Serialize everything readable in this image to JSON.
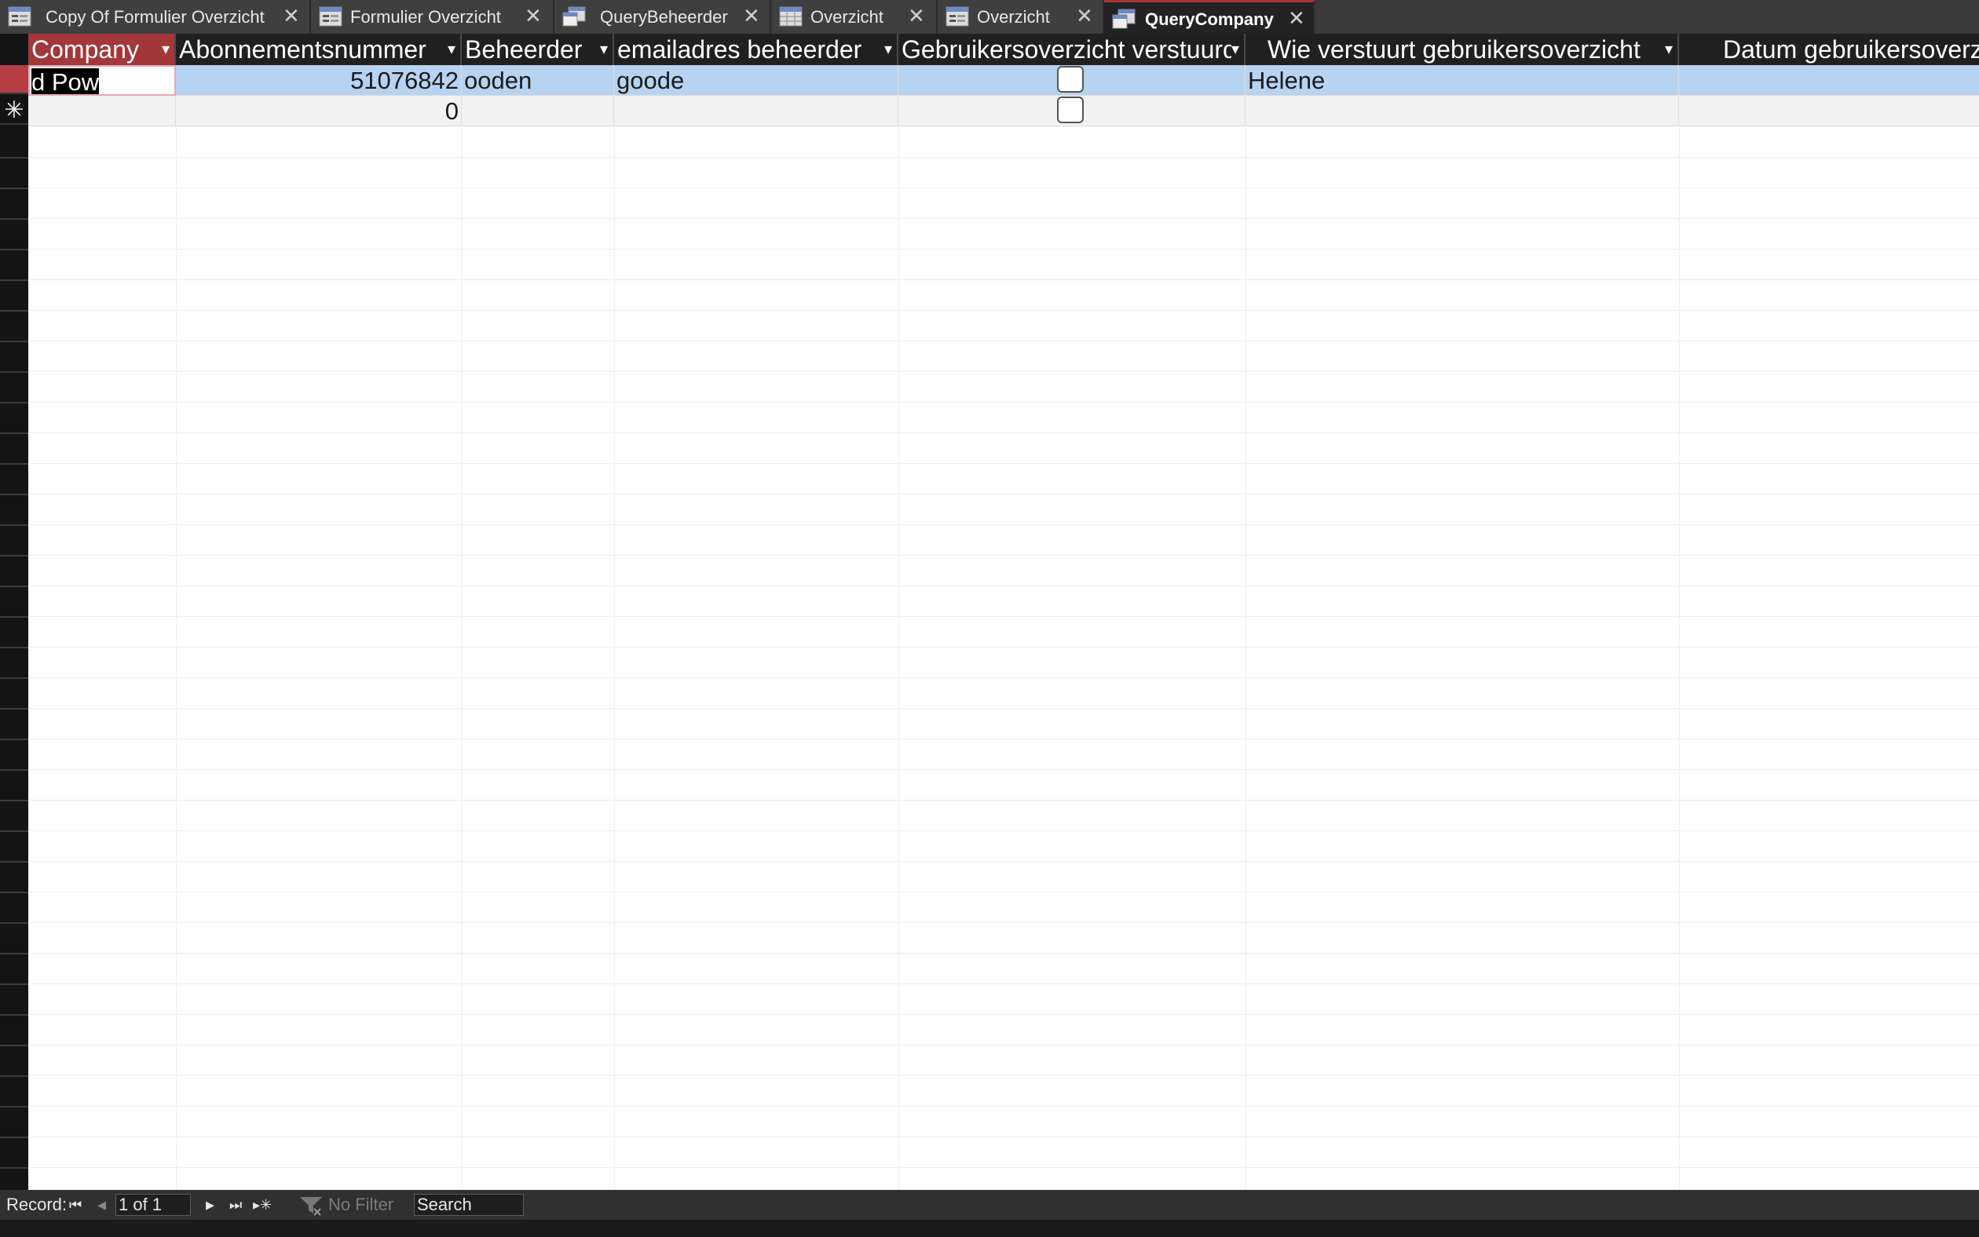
{
  "tabs": [
    {
      "label": "Copy Of Formulier Overzicht",
      "icon": "form-icon",
      "active": false
    },
    {
      "label": "Formulier Overzicht",
      "icon": "form-icon",
      "active": false
    },
    {
      "label": "QueryBeheerder",
      "icon": "query-icon",
      "active": false
    },
    {
      "label": "Overzicht",
      "icon": "table-icon",
      "active": false
    },
    {
      "label": "Overzicht",
      "icon": "form-icon",
      "active": false
    },
    {
      "label": "QueryCompany",
      "icon": "query-icon",
      "active": true
    }
  ],
  "close_glyph": "✕",
  "columns": [
    {
      "label": "Company",
      "dropdown": "▾"
    },
    {
      "label": "Abonnementsnummer",
      "dropdown": "▾"
    },
    {
      "label": "Beheerder",
      "dropdown": "▾"
    },
    {
      "label": "emailadres beheerder",
      "dropdown": "▾"
    },
    {
      "label": "Gebruikersoverzicht verstuurd",
      "dropdown": "▾"
    },
    {
      "label": "Wie verstuurt gebruikersoverzicht",
      "dropdown": "▾"
    },
    {
      "label": "Datum gebruikersoverzicht",
      "dropdown": ""
    }
  ],
  "rows": [
    {
      "company": "d Pow",
      "abonnementsnummer": "51076842",
      "beheerder": "ooden",
      "email": "goode",
      "verstuurd": false,
      "wie": "Helene",
      "datum": ""
    },
    {
      "company": "",
      "abonnementsnummer": "0",
      "beheerder": "",
      "email": "",
      "verstuurd": false,
      "wie": "",
      "datum": ""
    }
  ],
  "new_record_glyph": "✳",
  "statusbar": {
    "record_label": "Record:",
    "first": "⏮",
    "prev": "◂",
    "position": "1 of 1",
    "next": "▸",
    "last": "⏭",
    "new": "▸✳",
    "filter_label": "No Filter",
    "search_label": "Search"
  },
  "colors": {
    "accent": "#a4373a",
    "selected_row": "#b7d3f2"
  }
}
